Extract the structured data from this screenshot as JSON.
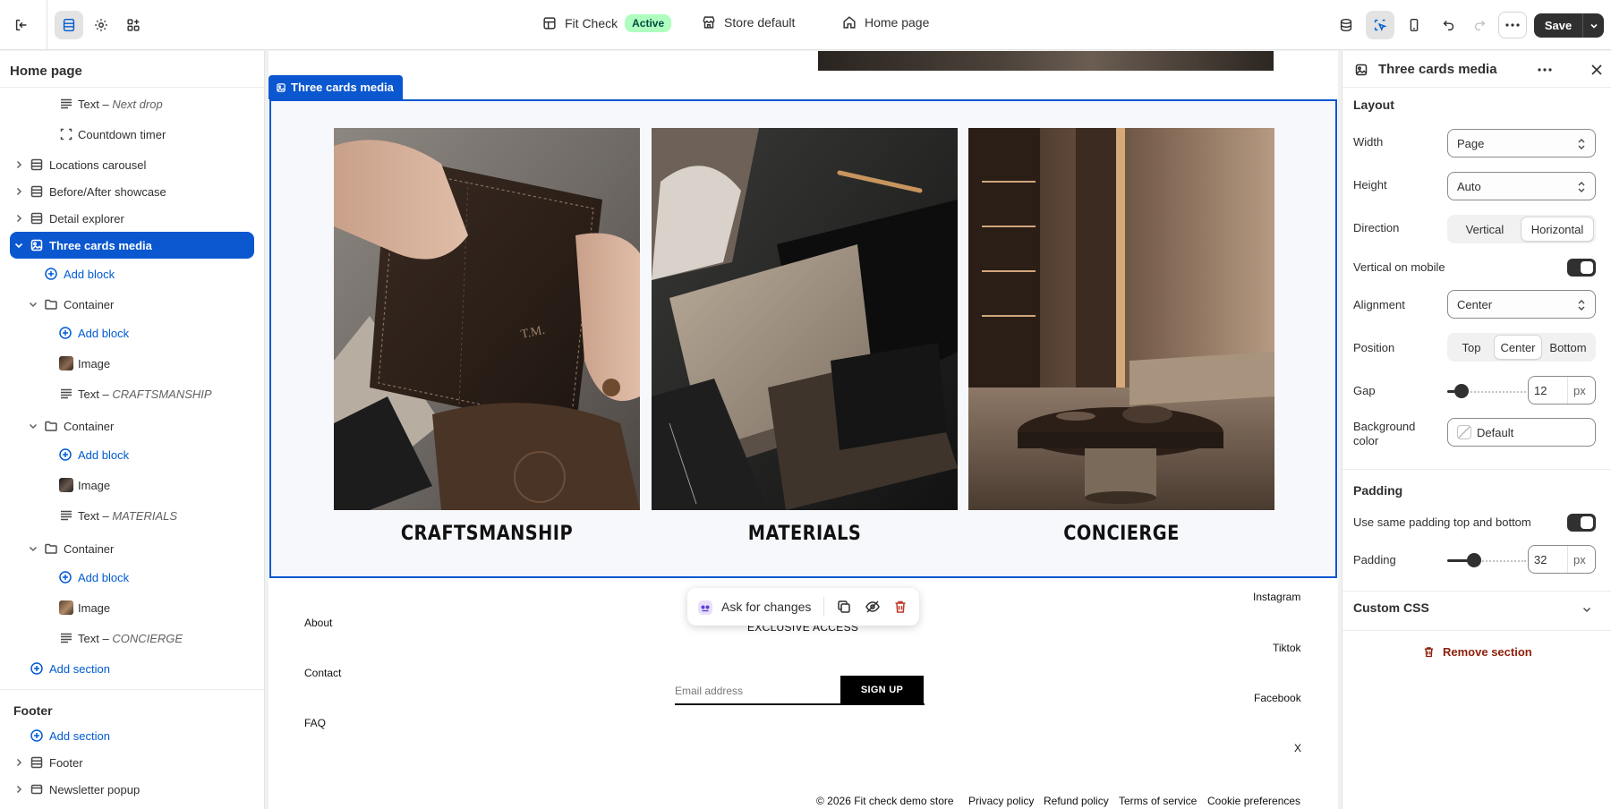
{
  "topbar": {
    "theme_name": "Fit Check",
    "theme_status": "Active",
    "store_label": "Store default",
    "page_label": "Home page",
    "save_label": "Save"
  },
  "sidebar": {
    "title": "Home page",
    "rows": [
      {
        "label": "Text",
        "detail": "Next drop"
      },
      {
        "label": "Countdown timer"
      },
      {
        "label": "Locations carousel"
      },
      {
        "label": "Before/After showcase"
      },
      {
        "label": "Detail explorer"
      },
      {
        "label": "Three cards media"
      },
      {
        "label": "Add block"
      },
      {
        "label": "Container"
      },
      {
        "label": "Add block"
      },
      {
        "label": "Image"
      },
      {
        "label": "Text",
        "detail": "CRAFTSMANSHIP"
      },
      {
        "label": "Container"
      },
      {
        "label": "Add block"
      },
      {
        "label": "Image"
      },
      {
        "label": "Text",
        "detail": "MATERIALS"
      },
      {
        "label": "Container"
      },
      {
        "label": "Add block"
      },
      {
        "label": "Image"
      },
      {
        "label": "Text",
        "detail": "CONCIERGE"
      },
      {
        "label": "Add section"
      }
    ],
    "footer_title": "Footer",
    "footer_rows": [
      {
        "label": "Add section"
      },
      {
        "label": "Footer"
      },
      {
        "label": "Newsletter popup"
      }
    ]
  },
  "canvas": {
    "selected_tag": "Three cards media",
    "cards": [
      {
        "caption": "CRAFTSMANSHIP"
      },
      {
        "caption": "MATERIALS"
      },
      {
        "caption": "CONCIERGE"
      }
    ],
    "ask_label": "Ask for changes",
    "footer_preview": {
      "left_links": [
        "About",
        "Contact",
        "FAQ"
      ],
      "right_links": [
        "Instagram",
        "Tiktok",
        "Facebook",
        "X"
      ],
      "newsletter_heading": "EXCLUSIVE ACCESS",
      "email_placeholder": "Email address",
      "signup_label": "SIGN UP",
      "copyright": "© 2026 Fit check demo store",
      "policies": [
        "Privacy policy",
        "Refund policy",
        "Terms of service",
        "Cookie preferences"
      ]
    }
  },
  "panel": {
    "title": "Three cards media",
    "layout_heading": "Layout",
    "width_label": "Width",
    "width_value": "Page",
    "height_label": "Height",
    "height_value": "Auto",
    "direction_label": "Direction",
    "direction_options": [
      "Vertical",
      "Horizontal"
    ],
    "direction_selected": "Horizontal",
    "vertical_mobile_label": "Vertical on mobile",
    "vertical_mobile_on": true,
    "alignment_label": "Alignment",
    "alignment_value": "Center",
    "position_label": "Position",
    "position_options": [
      "Top",
      "Center",
      "Bottom"
    ],
    "position_selected": "Center",
    "gap_label": "Gap",
    "gap_value": "12",
    "gap_unit": "px",
    "bg_label": "Background color",
    "bg_value": "Default",
    "padding_heading": "Padding",
    "same_padding_label": "Use same padding top and bottom",
    "same_padding_on": true,
    "padding_label": "Padding",
    "padding_value": "32",
    "padding_unit": "px",
    "custom_css_heading": "Custom CSS",
    "remove_label": "Remove section"
  },
  "colors": {
    "accent": "#0b57d0",
    "save_bg": "#303030",
    "badge_bg": "#affebf",
    "danger": "#8e1f0b"
  }
}
